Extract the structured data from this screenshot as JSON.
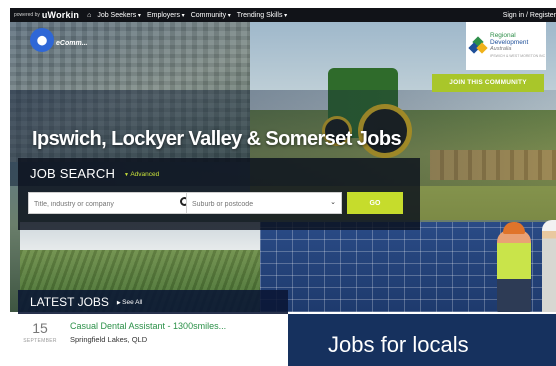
{
  "topnav": {
    "powered_by": "powered by",
    "brand": "uWorkin",
    "home_icon": "home-icon",
    "menu": [
      "Job Seekers",
      "Employers",
      "Community",
      "Trending Skills"
    ],
    "sign_in": "Sign in / Register"
  },
  "hero": {
    "logo_mark": "⬤",
    "logo_text": "eComm...",
    "partner": {
      "line1": "Regional",
      "line2": "Development",
      "line3": "Australia",
      "line4": "IPSWICH & WEST MORETON INC"
    },
    "join_label": "JOIN THIS COMMUNITY",
    "title": "Ipswich, Lockyer Valley & Somerset Jobs"
  },
  "search": {
    "title": "JOB SEARCH",
    "advanced": "Advanced",
    "keyword_placeholder": "Title, industry or company",
    "suburb_placeholder": "Suburb or postcode",
    "go_label": "GO"
  },
  "latest": {
    "title": "LATEST JOBS",
    "see_all": "See All",
    "jobs": [
      {
        "day": "15",
        "month": "SEPTEMBER",
        "title": "Casual Dental Assistant - 1300smiles...",
        "location": "Springfield Lakes, QLD"
      }
    ]
  },
  "locals": {
    "title": "Jobs for locals"
  },
  "colors": {
    "accent_green": "#a9c62a",
    "go_green": "#c6dc2c",
    "job_title_green": "#2b9048",
    "navy": "#16315e"
  }
}
